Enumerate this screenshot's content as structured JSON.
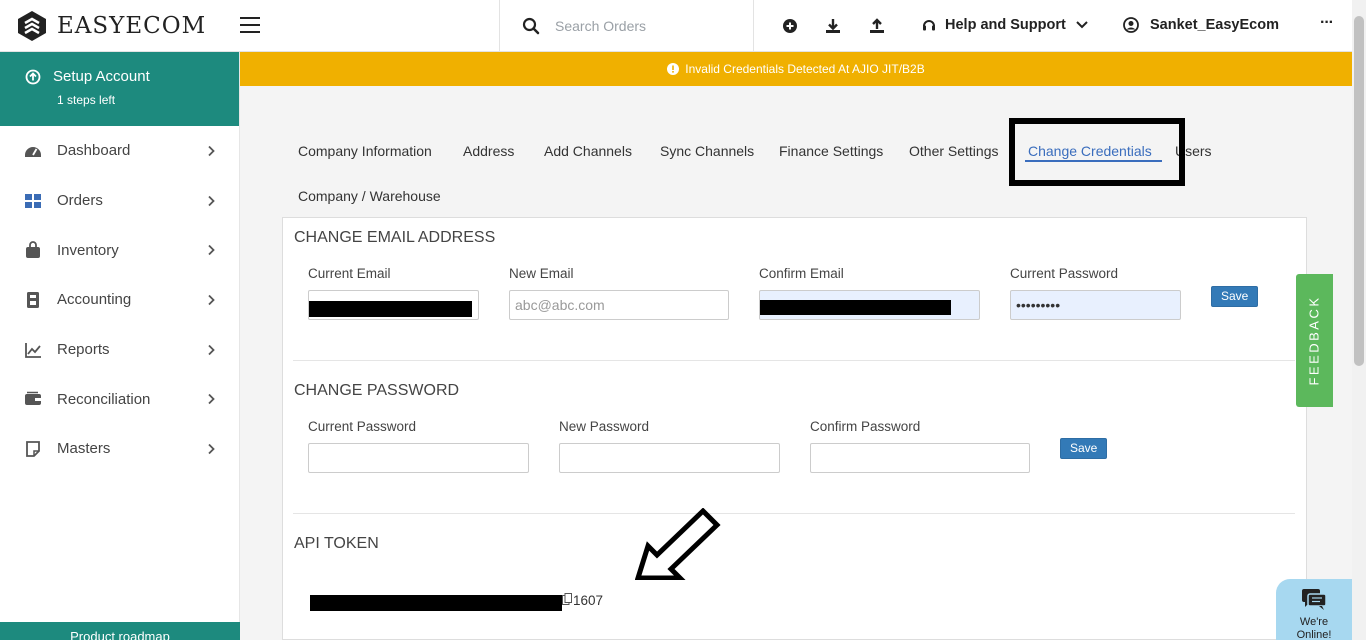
{
  "header": {
    "logo_text": "EASYECOM",
    "search_placeholder": "Search Orders",
    "help_label": "Help and Support",
    "user_name": "Sanket_EasyEcom",
    "more": "···"
  },
  "sidebar": {
    "setup_title": "Setup Account",
    "setup_subtitle": "1 steps left",
    "items": [
      {
        "label": "Dashboard",
        "icon": "dashboard-icon"
      },
      {
        "label": "Orders",
        "icon": "orders-icon"
      },
      {
        "label": "Inventory",
        "icon": "inventory-icon"
      },
      {
        "label": "Accounting",
        "icon": "accounting-icon"
      },
      {
        "label": "Reports",
        "icon": "reports-icon"
      },
      {
        "label": "Reconciliation",
        "icon": "reconciliation-icon"
      },
      {
        "label": "Masters",
        "icon": "masters-icon"
      }
    ],
    "roadmap_label": "Product roadmap"
  },
  "banner": {
    "text": "Invalid Credentials Detected At AJIO JIT/B2B",
    "color": "#f0b000"
  },
  "tabs": [
    "Company Information",
    "Address",
    "Add Channels",
    "Sync Channels",
    "Finance Settings",
    "Other Settings",
    "Change Credentials",
    "Users",
    "Company / Warehouse"
  ],
  "active_tab": "Change Credentials",
  "email_section": {
    "title": "CHANGE EMAIL ADDRESS",
    "current_email_label": "Current Email",
    "new_email_label": "New Email",
    "new_email_placeholder": "abc@abc.com",
    "confirm_email_label": "Confirm Email",
    "current_password_label": "Current Password",
    "current_password_value": "•••••••••",
    "save_label": "Save"
  },
  "password_section": {
    "title": "CHANGE PASSWORD",
    "current_password_label": "Current Password",
    "new_password_label": "New Password",
    "confirm_password_label": "Confirm Password",
    "save_label": "Save"
  },
  "api_section": {
    "title": "API TOKEN",
    "token_visible_tail": "1607"
  },
  "feedback_label": "FEEDBACK",
  "chat": {
    "line1": "We're",
    "line2": "Online!"
  },
  "colors": {
    "accent_teal": "#1d8a7e",
    "link_blue": "#3a6dbd",
    "button_blue": "#337ab7",
    "feedback_green": "#5cb85c"
  }
}
